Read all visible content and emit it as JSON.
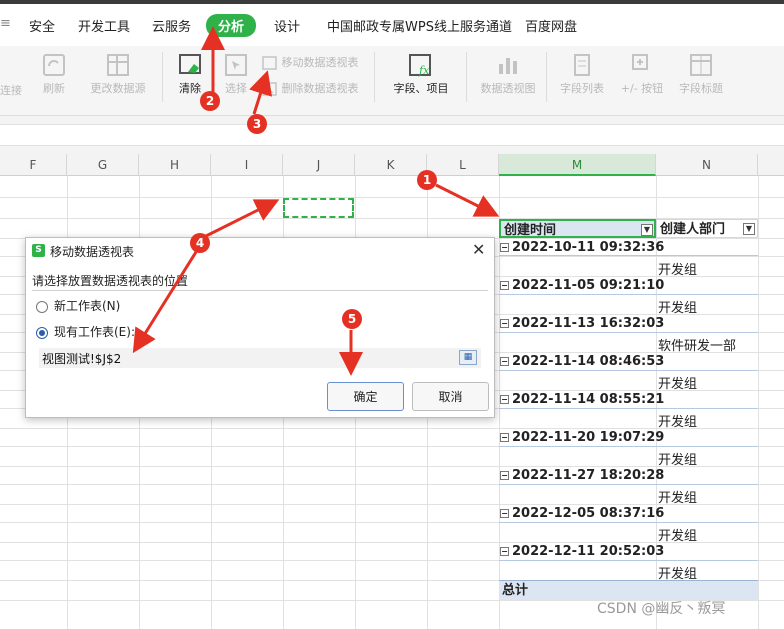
{
  "menu": {
    "items": [
      "安全",
      "开发工具",
      "云服务",
      "分析",
      "设计",
      "中国邮政专属WPS线上服务通道",
      "百度网盘"
    ],
    "active": "分析",
    "left_fragment": "≡"
  },
  "ribbon": {
    "left_fragment": "连接",
    "refresh": "刷新",
    "change_source": "更改数据源",
    "clear": "清除",
    "select": "选择",
    "move_pivot": "移动数据透视表",
    "delete_pivot": "删除数据透视表",
    "fields_items": "字段、项目",
    "pivot_chart": "数据透视图",
    "field_list": "字段列表",
    "plus_minus": "+/- 按钮",
    "field_headers": "字段标题"
  },
  "columns": [
    "F",
    "G",
    "H",
    "I",
    "J",
    "K",
    "L",
    "M",
    "N"
  ],
  "selected_column": "M",
  "pivot": {
    "header_time": "创建时间",
    "header_dept": "创建人部门",
    "rows": [
      {
        "time": "2022-10-11 09:32:36",
        "dept": "开发组"
      },
      {
        "time": "2022-11-05 09:21:10",
        "dept": "开发组"
      },
      {
        "time": "2022-11-13 16:32:03",
        "dept": "软件研发一部"
      },
      {
        "time": "2022-11-14 08:46:53",
        "dept": "开发组"
      },
      {
        "time": "2022-11-14 08:55:21",
        "dept": "开发组"
      },
      {
        "time": "2022-11-20 19:07:29",
        "dept": "开发组"
      },
      {
        "time": "2022-11-27 18:20:28",
        "dept": "开发组"
      },
      {
        "time": "2022-12-05 08:37:16",
        "dept": "开发组"
      },
      {
        "time": "2022-12-11 20:52:03",
        "dept": "开发组"
      }
    ],
    "total": "总计"
  },
  "dialog": {
    "title": "移动数据透视表",
    "prompt": "请选择放置数据透视表的位置",
    "option_new": "新工作表(N)",
    "option_existing": "现有工作表(E):",
    "selected_option": "existing",
    "reference": "视图测试!$J$2",
    "ok": "确定",
    "cancel": "取消",
    "close": "✕"
  },
  "annotations": [
    "1",
    "2",
    "3",
    "4",
    "5"
  ],
  "watermark": "CSDN @幽反丶叛冥",
  "colors": {
    "accent": "#2fb24a",
    "annotation": "#e53124",
    "pivot_header": "#dce6f2"
  }
}
